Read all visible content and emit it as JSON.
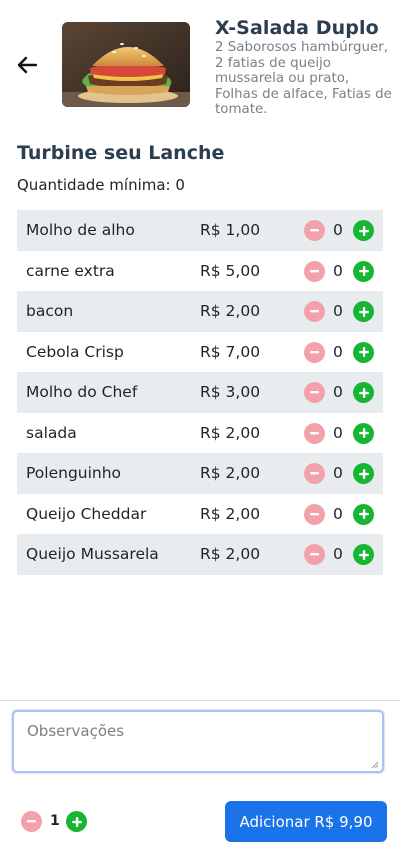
{
  "product": {
    "title": "X-Salada Duplo",
    "description": "2 Saborosos hambúrguer, 2 fatias de queijo mussarela ou prato, Folhas de alface, Fatias de tomate."
  },
  "section": {
    "title": "Turbine seu Lanche",
    "min_quantity": "Quantidade mínima: 0"
  },
  "extras": [
    {
      "name": "Molho de alho",
      "price": "R$ 1,00",
      "qty": "0"
    },
    {
      "name": "carne extra",
      "price": "R$ 5,00",
      "qty": "0"
    },
    {
      "name": "bacon",
      "price": "R$ 2,00",
      "qty": "0"
    },
    {
      "name": "Cebola Crisp",
      "price": "R$ 7,00",
      "qty": "0"
    },
    {
      "name": "Molho do Chef",
      "price": "R$ 3,00",
      "qty": "0"
    },
    {
      "name": "salada",
      "price": "R$ 2,00",
      "qty": "0"
    },
    {
      "name": "Polenguinho",
      "price": "R$ 2,00",
      "qty": "0"
    },
    {
      "name": "Queijo Cheddar",
      "price": "R$ 2,00",
      "qty": "0"
    },
    {
      "name": "Queijo Mussarela",
      "price": "R$ 2,00",
      "qty": "0"
    }
  ],
  "observations": {
    "placeholder": "Observações"
  },
  "footer": {
    "quantity": "1",
    "add_label": "Adicionar R$ 9,90"
  },
  "colors": {
    "accent": "#1a73e8",
    "plus": "#16b632",
    "minus": "#f3a1a9",
    "row_alt": "#e9ecef",
    "heading": "#2b3d4f"
  },
  "icons": {
    "back": "arrow-left-icon",
    "minus": "minus-circle-icon",
    "plus": "plus-circle-icon"
  }
}
